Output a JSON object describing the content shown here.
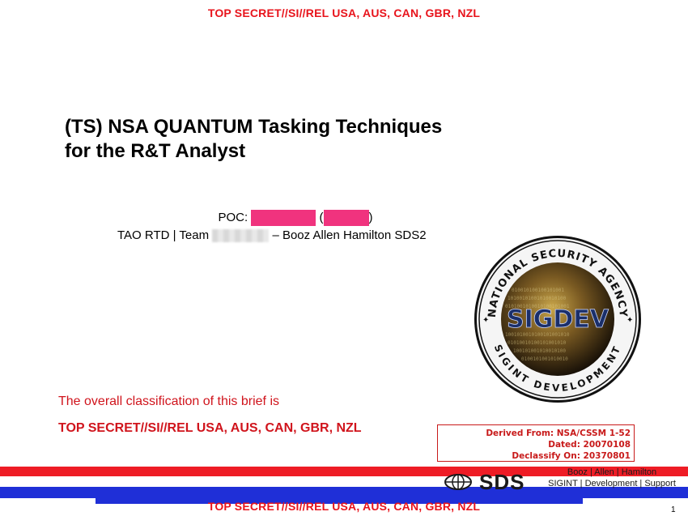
{
  "classification": {
    "top_banner": "TOP SECRET//SI//REL USA, AUS, CAN, GBR, NZL",
    "bottom_banner": "TOP SECRET//SI//REL USA, AUS, CAN, GBR, NZL"
  },
  "title": {
    "line1": "(TS) NSA QUANTUM Tasking Techniques",
    "line2": "for the R&T Analyst"
  },
  "poc": {
    "label": "POC:",
    "open_paren": "(",
    "close_paren": ")",
    "redaction_color": "#f0337e"
  },
  "team": {
    "prefix": "TAO RTD | Team",
    "suffix": "– Booz Allen Hamilton SDS2"
  },
  "overall": {
    "line1": "The overall classification of this brief is",
    "line2": "TOP SECRET//SI//REL USA, AUS, CAN, GBR, NZL"
  },
  "derived_box": {
    "line1": "Derived From: NSA/CSSM 1-52",
    "line2": "Dated: 20070108",
    "line3": "Declassify On: 20370801"
  },
  "seal": {
    "top_text": "NATIONAL SECURITY AGENCY",
    "center_text": "SIGDEV",
    "bottom_text": "SIGINT DEVELOPMENT"
  },
  "footer": {
    "sds_logo_text": "SDS",
    "booz_line": "Booz | Allen | Hamilton",
    "sigint_line": "SIGINT | Development | Support",
    "colors": {
      "red": "#ee1c25",
      "blue": "#1f2fd7"
    }
  },
  "page_number": "1"
}
